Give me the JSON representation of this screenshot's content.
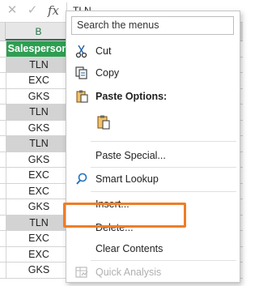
{
  "formula_bar": {
    "cancel_icon": "cancel-x-icon",
    "enter_icon": "checkmark-icon",
    "fx_label": "fx",
    "value": "TLN"
  },
  "sheet": {
    "column_label": "B",
    "header_cell": "Salesperson",
    "rows": [
      {
        "value": "TLN",
        "highlight": true
      },
      {
        "value": "EXC",
        "highlight": false
      },
      {
        "value": "GKS",
        "highlight": false
      },
      {
        "value": "TLN",
        "highlight": true
      },
      {
        "value": "GKS",
        "highlight": false
      },
      {
        "value": "TLN",
        "highlight": true
      },
      {
        "value": "GKS",
        "highlight": false
      },
      {
        "value": "EXC",
        "highlight": false
      },
      {
        "value": "EXC",
        "highlight": false
      },
      {
        "value": "GKS",
        "highlight": false
      },
      {
        "value": "TLN",
        "highlight": true
      },
      {
        "value": "EXC",
        "highlight": false
      },
      {
        "value": "EXC",
        "highlight": false
      },
      {
        "value": "GKS",
        "highlight": false
      }
    ]
  },
  "context_menu": {
    "search_placeholder": "Search the menus",
    "items": {
      "cut": "Cut",
      "copy": "Copy",
      "paste_options": "Paste Options:",
      "paste_special": "Paste Special...",
      "smart_lookup": "Smart Lookup",
      "insert": "Insert...",
      "delete": "Delete...",
      "clear_contents": "Clear Contents",
      "quick_analysis": "Quick Analysis"
    },
    "highlight_color": "#ee7d27"
  }
}
